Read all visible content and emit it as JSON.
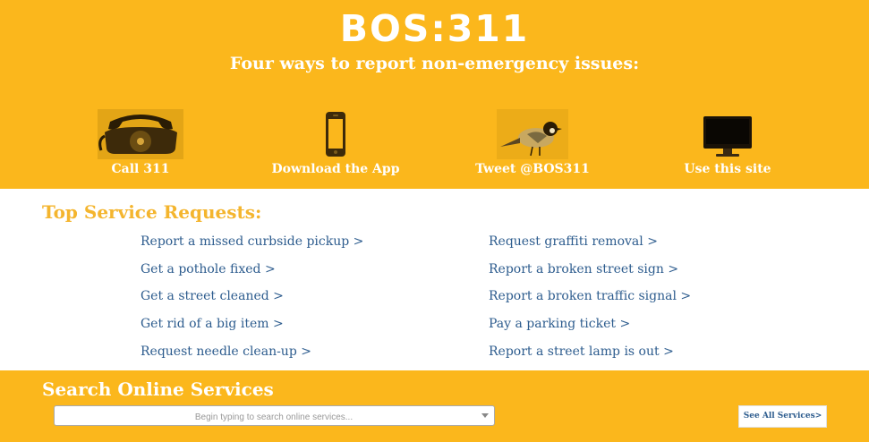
{
  "header": {
    "logo": "BOS:311",
    "tagline": "Four ways to report non-emergency issues:"
  },
  "ways": [
    {
      "label": "Call 311",
      "icon": "phone-icon"
    },
    {
      "label": "Download the App",
      "icon": "smartphone-icon"
    },
    {
      "label": "Tweet @BOS311",
      "icon": "bird-icon"
    },
    {
      "label": "Use this site",
      "icon": "monitor-icon"
    }
  ],
  "top_requests": {
    "title": "Top Service Requests:",
    "left": [
      "Report a missed curbside pickup >",
      "Get a pothole fixed >",
      "Get a street cleaned >",
      "Get rid of a big item >",
      "Request needle clean-up >"
    ],
    "right": [
      "Request graffiti removal >",
      "Report a broken street sign >",
      "Report a broken traffic signal >",
      "Pay a parking ticket >",
      "Report a street lamp is out >"
    ]
  },
  "search": {
    "title": "Search Online Services",
    "placeholder": "Begin typing to search online services...",
    "see_all": "See All Services>"
  },
  "colors": {
    "brand_yellow": "#fbb71c",
    "heading_gold": "#f4b52e",
    "link_blue": "#2d5c8e"
  }
}
